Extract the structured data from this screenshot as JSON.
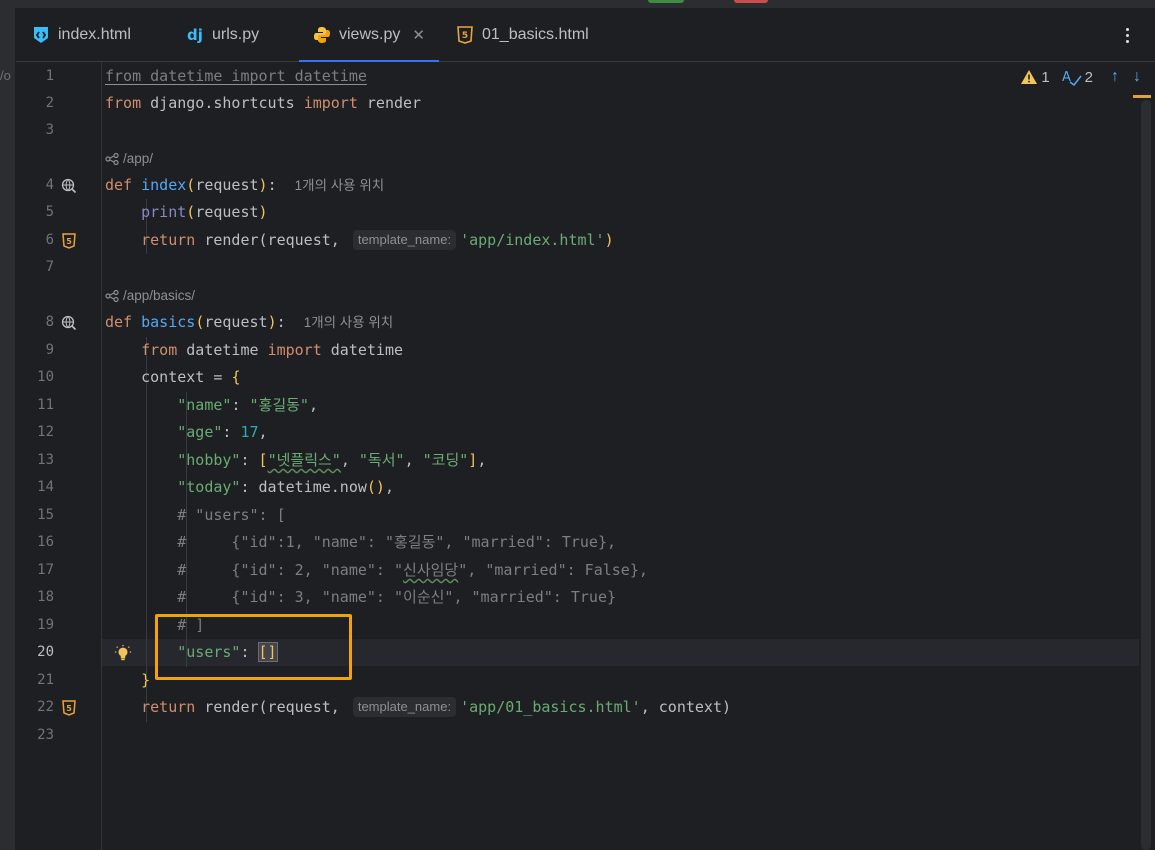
{
  "tabs": [
    {
      "label": "index.html",
      "icon": "html-file-icon"
    },
    {
      "label": "urls.py",
      "icon": "django-icon"
    },
    {
      "label": "views.py",
      "icon": "python-icon",
      "active": true
    },
    {
      "label": "01_basics.html",
      "icon": "html5-icon"
    }
  ],
  "inspection": {
    "warnings": "1",
    "typos": "2"
  },
  "left_fragment": "/o",
  "routes": {
    "index": "/app/",
    "basics": "/app/basics/"
  },
  "hints": {
    "usage": "1개의 사용 위치",
    "template_name": "template_name:"
  },
  "line_numbers": [
    "1",
    "2",
    "3",
    "4",
    "5",
    "6",
    "7",
    "8",
    "9",
    "10",
    "11",
    "12",
    "13",
    "14",
    "15",
    "16",
    "17",
    "18",
    "19",
    "20",
    "21",
    "22",
    "23"
  ],
  "code": {
    "l1": "from datetime import datetime",
    "l2a": "from",
    "l2b": " django.shortcuts ",
    "l2c": "import",
    "l2d": " render",
    "l4a": "def",
    "l4b": "index",
    "l4c": "request",
    "l5a": "print",
    "l5b": "request",
    "l6a": "return",
    "l6b": " render(request, ",
    "l6c": "'app/index.html'",
    "l8a": "def",
    "l8b": "basics",
    "l8c": "request",
    "l9a": "from",
    "l9b": " datetime ",
    "l9c": "import",
    "l9d": " datetime",
    "l10": "context = ",
    "l11k": "\"name\"",
    "l11v": "\"홍길동\"",
    "l12k": "\"age\"",
    "l12v": "17",
    "l13k": "\"hobby\"",
    "l13v1": "\"넷플릭스\"",
    "l13v2": "\"독서\"",
    "l13v3": "\"코딩\"",
    "l14k": "\"today\"",
    "l14v": "datetime.now",
    "l15": "# \"users\": [",
    "l16": "#     {\"id\":1, \"name\": \"홍길동\", \"married\": True},",
    "l17a": "#     {\"id\": 2, \"name\": \"",
    "l17b": "신사임당",
    "l17c": "\", \"married\": False},",
    "l18": "#     {\"id\": 3, \"name\": \"이순신\", \"married\": True}",
    "l19": "# ]",
    "l20k": "\"users\"",
    "l20v": "[]",
    "l22a": "return",
    "l22b": " render(request, ",
    "l22c": "'app/01_basics.html'",
    "l22d": ", context)"
  },
  "colors": {
    "accent": "#3574f0",
    "highlight_box": "#f0a30a",
    "keyword": "#cf8e6d",
    "string": "#6aab73",
    "function": "#56a8f5"
  }
}
